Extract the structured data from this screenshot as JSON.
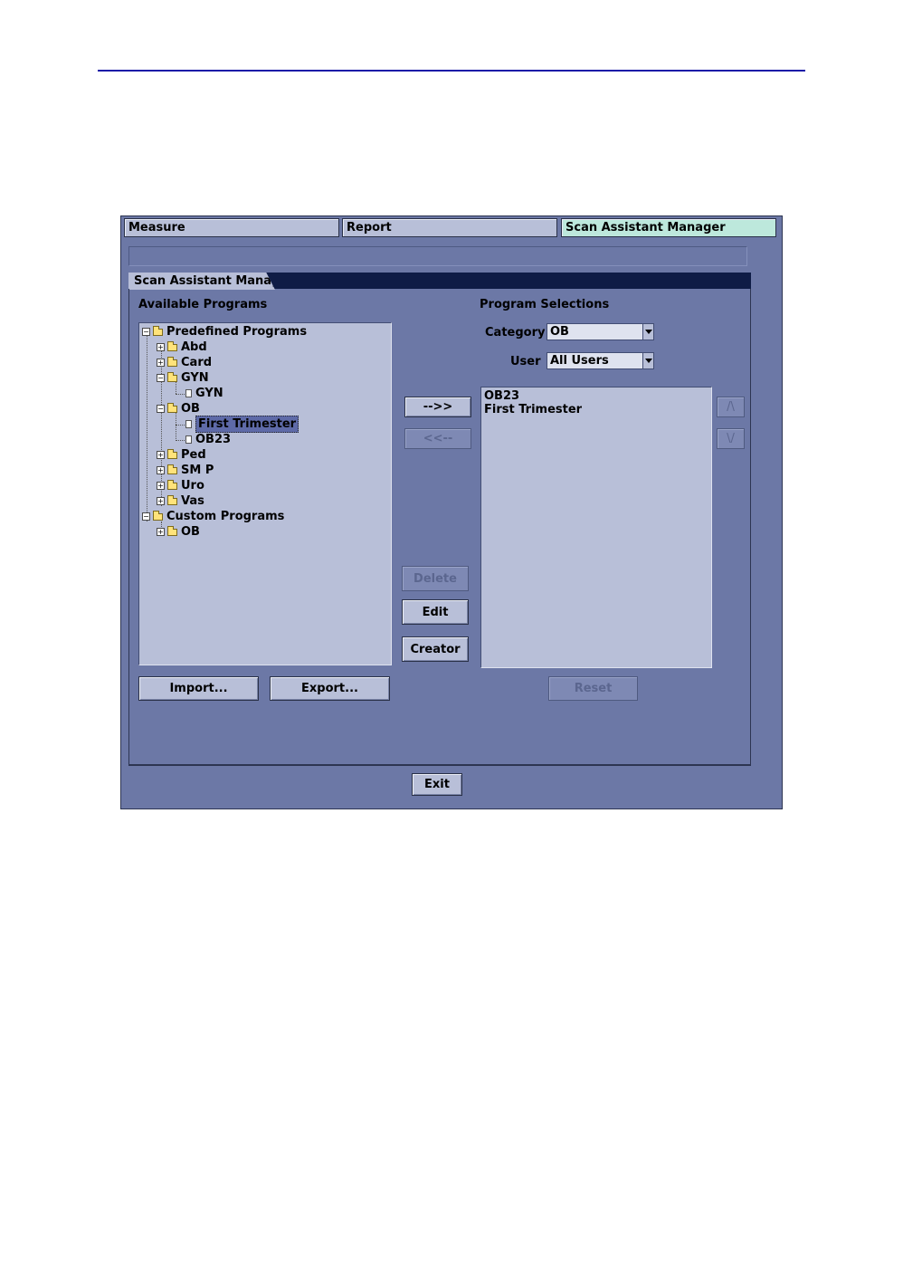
{
  "tabs": [
    {
      "label": "Measure",
      "active": false
    },
    {
      "label": "Report",
      "active": false
    },
    {
      "label": "Scan Assistant Manager",
      "active": true
    }
  ],
  "section_tab": "Scan Assistant Manager",
  "available": {
    "title": "Available Programs",
    "tree": {
      "predefined": "Predefined Programs",
      "abd": "Abd",
      "card": "Card",
      "gyn": "GYN",
      "gyn_child": "GYN",
      "ob": "OB",
      "ob_child1": "First Trimester",
      "ob_child2": "OB23",
      "ped": "Ped",
      "smp": "SM P",
      "uro": "Uro",
      "vas": "Vas",
      "custom": "Custom Programs",
      "custom_ob": "OB"
    },
    "import_label": "Import...",
    "export_label": "Export..."
  },
  "transfer": {
    "add_label": "-->>",
    "remove_label": "<<--"
  },
  "actions": {
    "delete_label": "Delete",
    "edit_label": "Edit",
    "creator_label": "Creator"
  },
  "selections": {
    "title": "Program Selections",
    "category_label": "Category",
    "category_value": "OB",
    "user_label": "User",
    "user_value": "All Users",
    "items": [
      "OB23",
      "First Trimester"
    ],
    "up_label": "/\\",
    "down_label": "\\/",
    "reset_label": "Reset"
  },
  "exit_label": "Exit",
  "colors": {
    "window": "#6c78a6",
    "panel": "#b8bfd8",
    "active_tab": "#bde8dc",
    "section_bar": "#0f1c46",
    "header_rule": "#1a1aa8"
  }
}
